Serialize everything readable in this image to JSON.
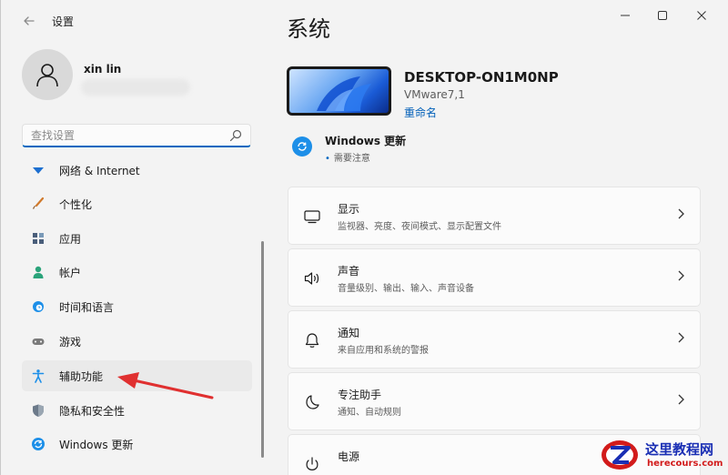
{
  "titlebar": {
    "back_icon": "arrow-left-icon",
    "title": "设置",
    "minimize_icon": "minimize-icon",
    "maximize_icon": "maximize-icon",
    "close_icon": "close-icon"
  },
  "user": {
    "name": "xin lin",
    "avatar_icon": "person-icon"
  },
  "search": {
    "placeholder": "查找设置",
    "value": "",
    "icon": "search-icon"
  },
  "sidebar": {
    "items": [
      {
        "label": "网络 & Internet",
        "icon": "wifi-icon",
        "color": "#1d6fd0"
      },
      {
        "label": "个性化",
        "icon": "brush-icon",
        "color": "#d07a2c"
      },
      {
        "label": "应用",
        "icon": "apps-icon",
        "color": "#4a5e7a"
      },
      {
        "label": "帐户",
        "icon": "account-icon",
        "color": "#2aa37a"
      },
      {
        "label": "时间和语言",
        "icon": "globe-clock-icon",
        "color": "#1d8fe8"
      },
      {
        "label": "游戏",
        "icon": "gamepad-icon",
        "color": "#7a7a7a"
      },
      {
        "label": "辅助功能",
        "icon": "accessibility-icon",
        "color": "#1d8fe8"
      },
      {
        "label": "隐私和安全性",
        "icon": "shield-icon",
        "color": "#6c7a8a"
      },
      {
        "label": "Windows 更新",
        "icon": "update-icon",
        "color": "#1d8fe8"
      }
    ],
    "active_index": 6
  },
  "main": {
    "page_title": "系统",
    "device": {
      "name": "DESKTOP-ON1M0NP",
      "model": "VMware7,1",
      "rename_label": "重命名"
    },
    "update": {
      "title": "Windows 更新",
      "status": "需要注意",
      "icon": "update-icon"
    },
    "cards": [
      {
        "title": "显示",
        "subtitle": "监视器、亮度、夜间模式、显示配置文件",
        "icon": "monitor-icon"
      },
      {
        "title": "声音",
        "subtitle": "音量级别、输出、输入、声音设备",
        "icon": "speaker-icon"
      },
      {
        "title": "通知",
        "subtitle": "来自应用和系统的警报",
        "icon": "bell-icon"
      },
      {
        "title": "专注助手",
        "subtitle": "通知、自动规则",
        "icon": "moon-icon"
      },
      {
        "title": "电源",
        "subtitle": "",
        "icon": "power-icon"
      }
    ]
  },
  "watermark": {
    "title": "这里教程网",
    "url": "herecours.com"
  },
  "colors": {
    "accent": "#0067c0",
    "link": "#005fb8",
    "annotation_arrow": "#e03030"
  }
}
